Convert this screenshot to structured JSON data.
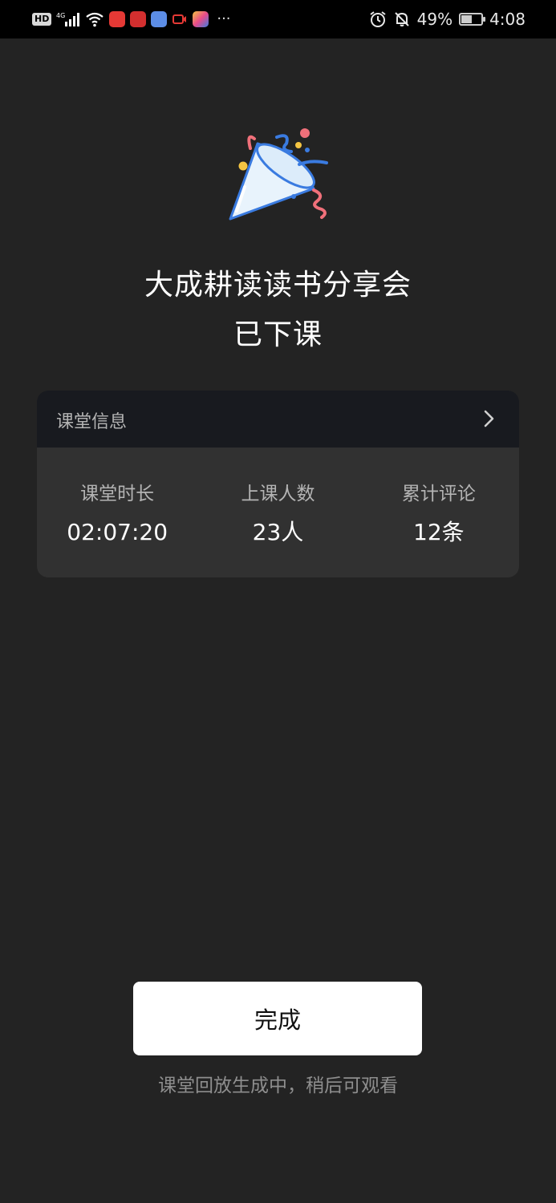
{
  "status_bar": {
    "network": "4G",
    "battery_text": "49%",
    "battery_level": 0.49,
    "time": "4:08",
    "more_indicator": "···",
    "icons": [
      "hd-icon",
      "signal-icon",
      "wifi-icon",
      "alarm-icon",
      "mute-icon",
      "battery-icon"
    ]
  },
  "header": {
    "course_name": "大成耕读读书分享会",
    "status": "已下课"
  },
  "info_card": {
    "title": "课堂信息",
    "stats": [
      {
        "label": "课堂时长",
        "value": "02:07:20"
      },
      {
        "label": "上课人数",
        "value": "23人"
      },
      {
        "label": "累计评论",
        "value": "12条"
      }
    ]
  },
  "actions": {
    "done_label": "完成",
    "hint": "课堂回放生成中，稍后可观看"
  },
  "colors": {
    "background": "#232323",
    "card_header": "#181a1f",
    "card_body": "#313131",
    "button_bg": "#ffffff",
    "confetti_blue": "#3a7be0",
    "confetti_red": "#f0707a",
    "confetti_yellow": "#f5c542"
  }
}
